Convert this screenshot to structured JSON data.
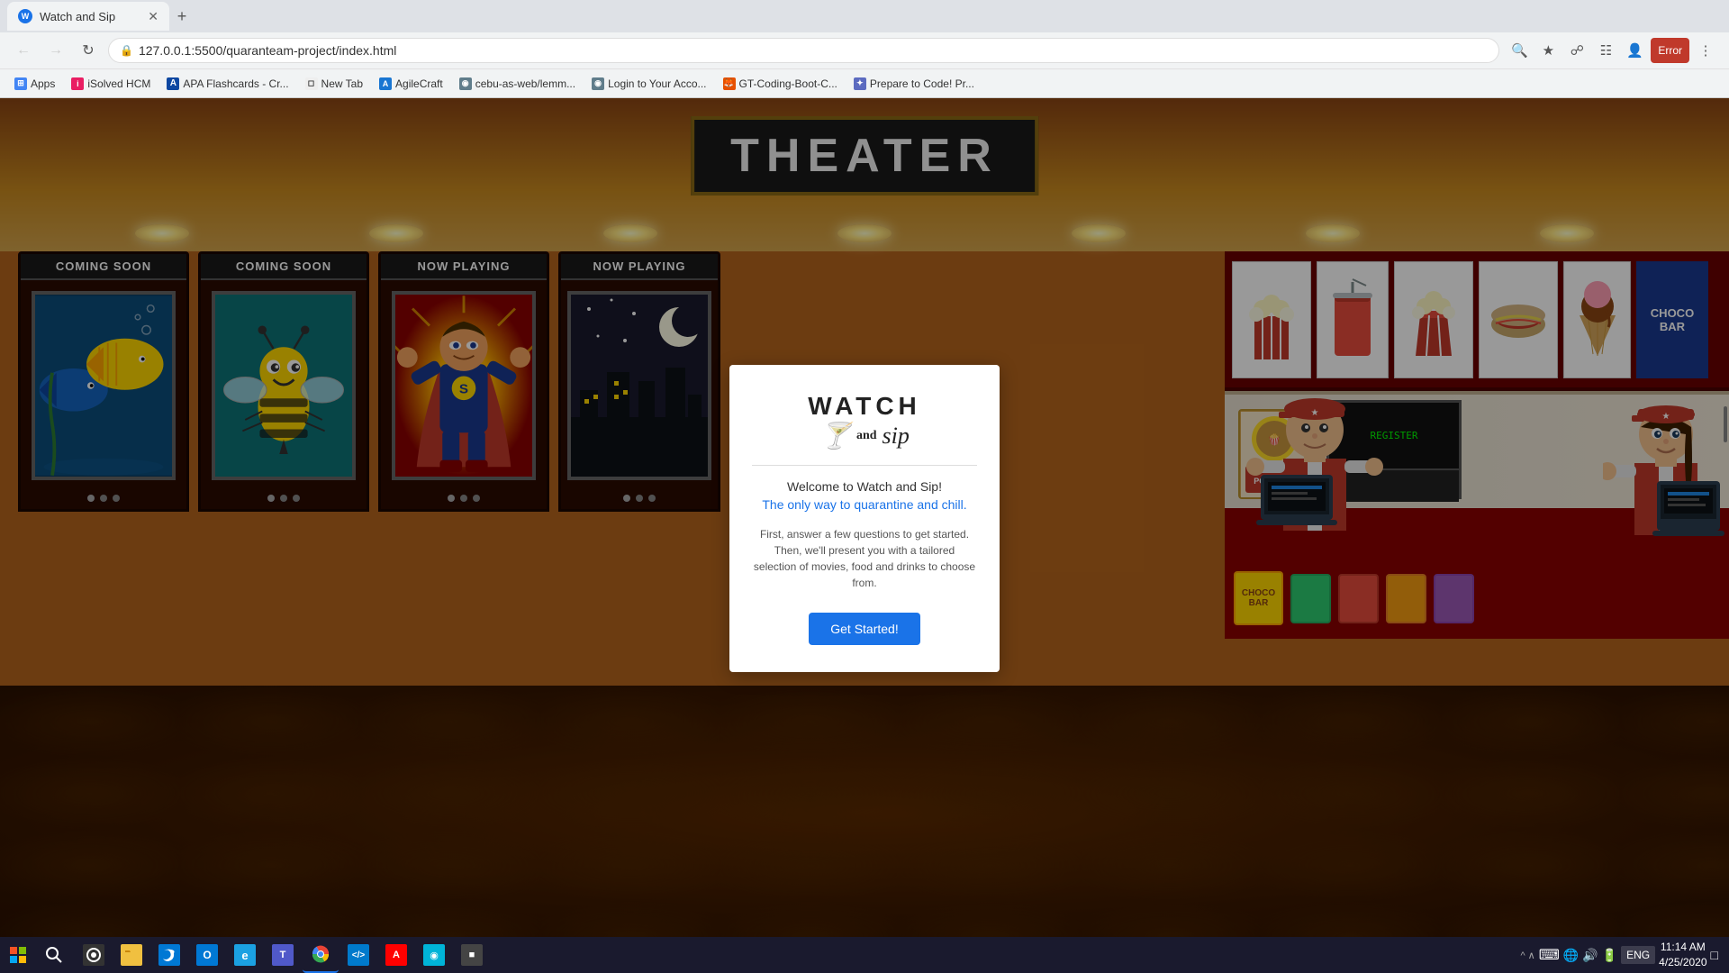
{
  "browser": {
    "tab": {
      "title": "Watch and Sip",
      "favicon": "W"
    },
    "url": "127.0.0.1:5500/quaranteam-project/index.html",
    "nav": {
      "back": "←",
      "forward": "→",
      "refresh": "↻",
      "home": "⌂"
    },
    "bookmarks": [
      {
        "label": "Apps",
        "icon": "⊞"
      },
      {
        "label": "iSolved HCM",
        "icon": "i"
      },
      {
        "label": "APA Flashcards - Cr...",
        "icon": "A"
      },
      {
        "label": "New Tab",
        "icon": "◻"
      },
      {
        "label": "AgileCraft",
        "icon": "A"
      },
      {
        "label": "cebu-as-web/lemm...",
        "icon": "◉"
      },
      {
        "label": "Login to Your Acco...",
        "icon": "◉"
      },
      {
        "label": "GT-Coding-Boot-C...",
        "icon": "🦊"
      },
      {
        "label": "Prepare to Code! Pr...",
        "icon": "✦"
      }
    ]
  },
  "theater": {
    "sign_text": "THEATER",
    "posters": [
      {
        "header": "COMING SOON",
        "type": "fish"
      },
      {
        "header": "COMING SOON",
        "type": "bee"
      },
      {
        "header": "NOW PLAYING",
        "type": "hero"
      },
      {
        "header": "NOW PLAYING",
        "type": "placeholder"
      }
    ]
  },
  "modal": {
    "logo_title": "WATCH",
    "logo_and": "and",
    "logo_sip": "sip",
    "welcome_line1": "Welcome to Watch and Sip!",
    "welcome_line2": "The only way to quarantine and chill.",
    "description": "First, answer a few questions to get started. Then, we'll present you with a tailored selection of movies, food and drinks to choose from.",
    "cta_button": "Get Started!"
  },
  "taskbar": {
    "time": "11:14 AM",
    "date": "4/25/2020",
    "language": "ENG"
  },
  "concession": {
    "choco_bar": "CHOCO BAR"
  }
}
